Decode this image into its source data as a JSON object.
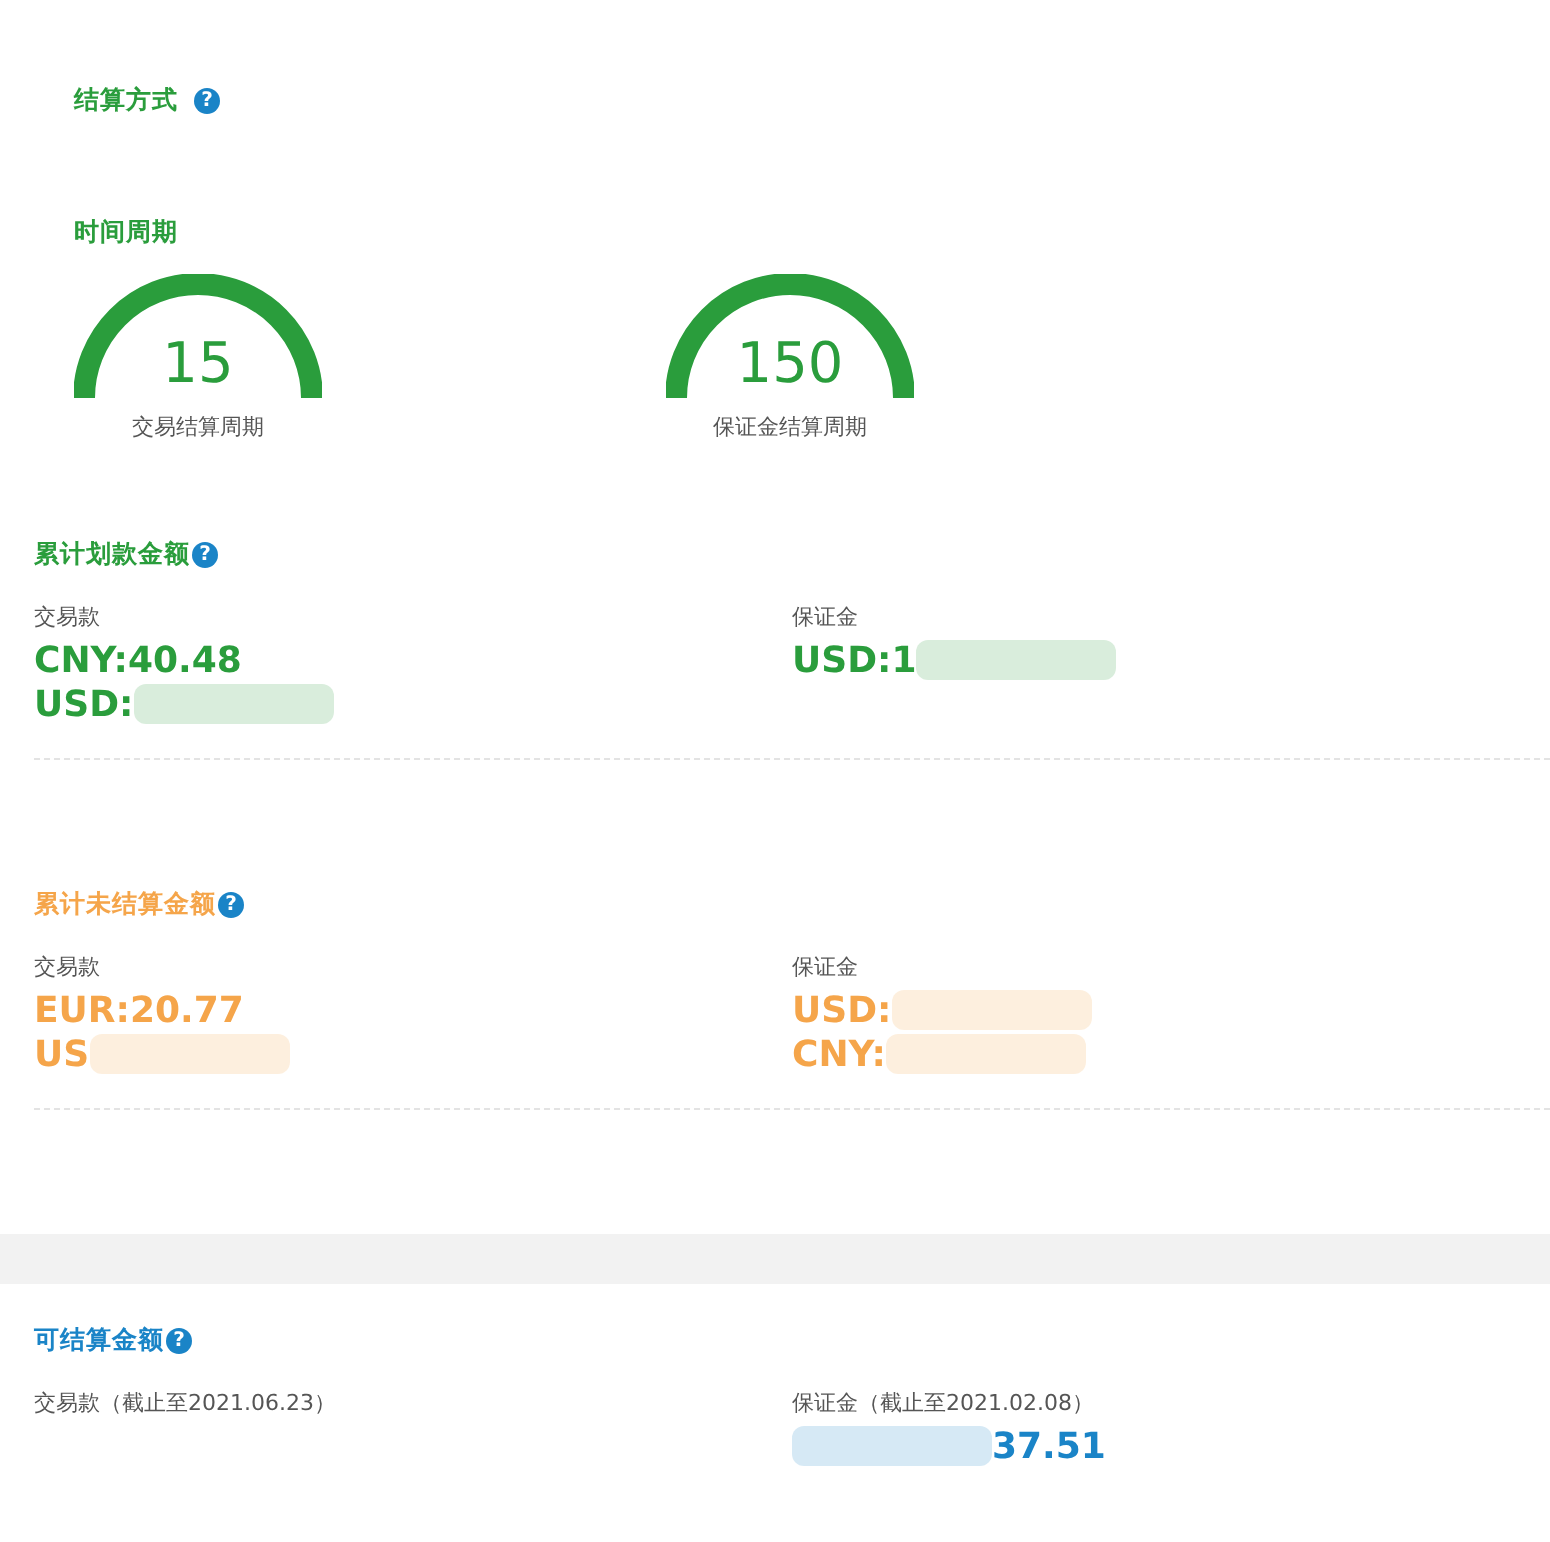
{
  "settlement_method": {
    "title": "结算方式",
    "help": "?"
  },
  "time_period": {
    "title": "时间周期",
    "gauges": [
      {
        "value": "15",
        "label": "交易结算周期",
        "level": 1
      },
      {
        "value": "150",
        "label": "保证金结算周期",
        "level": 1
      }
    ]
  },
  "sections": [
    {
      "title": "累计划款金额",
      "help": "?",
      "color": "#2a9d3c",
      "columns": [
        {
          "label": "交易款",
          "lines": [
            {
              "text": "CNY:40.48",
              "kind": "plain"
            },
            {
              "text": "USD:",
              "kind": "masked_after"
            }
          ]
        },
        {
          "label": "保证金",
          "lines": [
            {
              "text": "USD:1",
              "kind": "masked_after"
            }
          ]
        }
      ]
    },
    {
      "title": "累计未结算金额",
      "help": "?",
      "color": "#f5a54a",
      "columns": [
        {
          "label": "交易款",
          "lines": [
            {
              "text": "EUR:20.77",
              "kind": "plain"
            },
            {
              "text": "US",
              "kind": "masked_after"
            }
          ]
        },
        {
          "label": "保证金",
          "lines": [
            {
              "text": "USD:",
              "kind": "masked_after"
            },
            {
              "text": "CNY:",
              "kind": "masked_after"
            }
          ]
        }
      ]
    },
    {
      "title": "可结算金额",
      "help": "?",
      "color": "#1a84c7",
      "columns": [
        {
          "label": "交易款（截止至2021.06.23）"
        },
        {
          "label": "保证金（截止至2021.02.08）",
          "lines": [
            {
              "text": "37.51",
              "kind": "masked_before"
            }
          ]
        }
      ]
    }
  ]
}
